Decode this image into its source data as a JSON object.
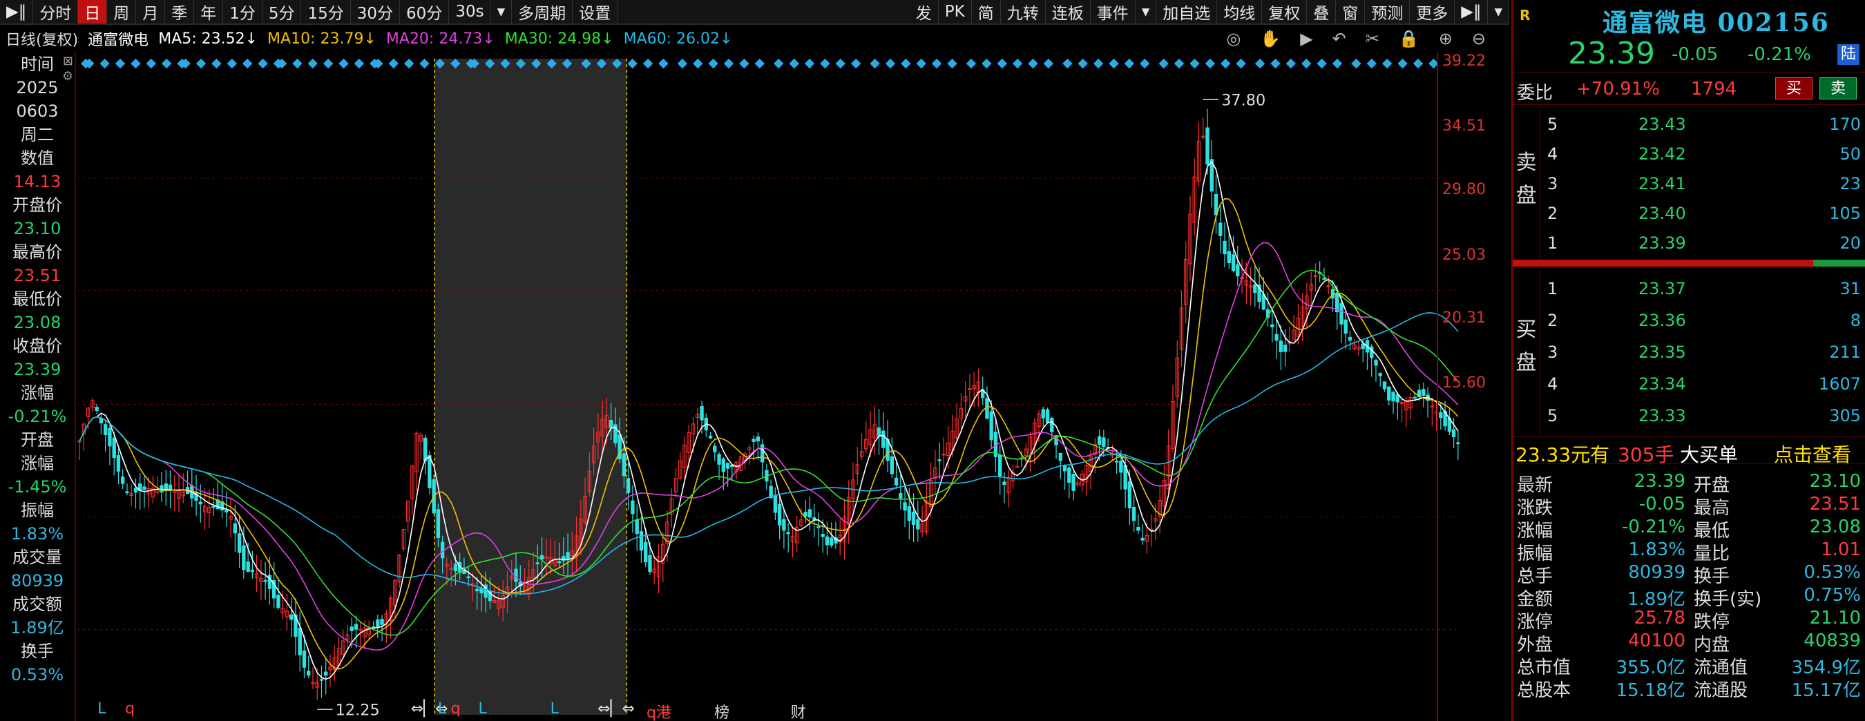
{
  "toolbar": {
    "left": [
      "▶‖",
      "分时",
      "日",
      "周",
      "月",
      "季",
      "年",
      "1分",
      "5分",
      "15分",
      "30分",
      "60分",
      "30s",
      "▾",
      "多周期",
      "设置"
    ],
    "active_index": 2,
    "right": [
      "发",
      "PK",
      "简",
      "九转",
      "连板",
      "事件",
      "▾",
      "加自选",
      "均线",
      "复权",
      "叠",
      "窗",
      "预测",
      "更多",
      "▶‖",
      "▾"
    ]
  },
  "maline": {
    "period": "日线(复权)",
    "name": "通富微电",
    "ma5": "MA5: 23.52↓",
    "ma10": "MA10: 23.79↓",
    "ma20": "MA20: 24.73↓",
    "ma30": "MA30: 24.98↓",
    "ma60": "MA60: 26.02↓",
    "tools": [
      "◎",
      "✋",
      "▶",
      "↶",
      "✂",
      "🔒",
      "⊕",
      "⊖"
    ]
  },
  "left": [
    {
      "t": "时间",
      "c": "w"
    },
    {
      "t": "2025",
      "c": "w"
    },
    {
      "t": "0603",
      "c": "w"
    },
    {
      "t": "周二",
      "c": "w"
    },
    {
      "t": "数值",
      "c": "w"
    },
    {
      "t": "14.13",
      "c": "r"
    },
    {
      "t": "开盘价",
      "c": "w"
    },
    {
      "t": "23.10",
      "c": "g"
    },
    {
      "t": "最高价",
      "c": "w"
    },
    {
      "t": "23.51",
      "c": "r"
    },
    {
      "t": "最低价",
      "c": "w"
    },
    {
      "t": "23.08",
      "c": "g"
    },
    {
      "t": "收盘价",
      "c": "w"
    },
    {
      "t": "23.39",
      "c": "g"
    },
    {
      "t": "涨幅",
      "c": "w"
    },
    {
      "t": "-0.21%",
      "c": "g"
    },
    {
      "t": "开盘",
      "c": "w"
    },
    {
      "t": "涨幅",
      "c": "w"
    },
    {
      "t": "-1.45%",
      "c": "g"
    },
    {
      "t": "振幅",
      "c": "w"
    },
    {
      "t": "1.83%",
      "c": "c"
    },
    {
      "t": "成交量",
      "c": "w"
    },
    {
      "t": "80939",
      "c": "c"
    },
    {
      "t": "成交额",
      "c": "w"
    },
    {
      "t": "1.89亿",
      "c": "c"
    },
    {
      "t": "换手",
      "c": "w"
    },
    {
      "t": "0.53%",
      "c": "c"
    }
  ],
  "yticks": [
    "39.22",
    "34.51",
    "29.80",
    "25.03",
    "20.31",
    "15.60"
  ],
  "chart_data": {
    "type": "candlestick",
    "title": "",
    "y_ticks": [
      39.22,
      34.51,
      29.8,
      25.03,
      20.31,
      15.6
    ],
    "ylim": [
      13.2,
      39.22
    ],
    "annotations": [
      {
        "text": "37.80",
        "value": 37.8,
        "kind": "high"
      },
      {
        "text": "12.25",
        "value": 12.25,
        "kind": "low"
      }
    ],
    "highlight_range": [
      0.2583,
      0.3973
    ],
    "close_series": [
      23.5,
      24.8,
      23.6,
      22.9,
      21.9,
      21.7,
      21.2,
      20.8,
      21.3,
      21.9,
      21.5,
      20.7,
      20.1,
      19.9,
      18.3,
      18.6,
      17.9,
      16.2,
      15.7,
      14.1,
      13.8,
      14.1,
      14.6,
      14.9,
      15.2,
      15.9,
      16.4,
      17.9,
      20.2,
      23.8,
      21.3,
      19.1,
      18.6,
      17.9,
      16.7,
      16.4,
      17.0,
      18.4,
      17.6,
      17.9,
      18.1,
      18.3,
      19.1,
      20.9,
      23.2,
      24.2,
      22.8,
      21.5,
      19.6,
      18.1,
      18.9,
      21.3,
      23.6,
      25.2,
      24.1,
      22.1,
      21.9,
      22.6,
      23.9,
      22.0,
      20.1,
      19.1,
      19.8,
      20.1,
      19.6,
      19.8,
      21.4,
      22.6,
      23.9,
      23.2,
      22.1,
      20.4,
      19.3,
      21.6,
      22.9,
      24.8,
      26.1,
      25.9,
      23.1,
      21.2,
      22.5,
      23.7,
      24.9,
      23.8,
      22.1,
      21.3,
      22.8,
      23.9,
      23.1,
      21.9,
      20.1,
      19.6,
      20.6,
      22.4,
      26.8,
      32.2,
      36.8,
      34.2,
      31.8,
      30.3,
      29.6,
      29.0,
      28.7,
      27.6,
      28.4,
      29.1,
      30.1,
      29.9,
      28.9,
      28.0,
      27.2,
      26.1,
      24.9,
      25.4,
      25.9,
      25.6,
      24.4,
      23.5,
      23.4
    ],
    "series": [
      {
        "name": "MA5",
        "value": 23.52,
        "color": "#ffffff"
      },
      {
        "name": "MA10",
        "value": 23.79,
        "color": "#f0c000"
      },
      {
        "name": "MA20",
        "value": 24.73,
        "color": "#e040e0"
      },
      {
        "name": "MA30",
        "value": 24.98,
        "color": "#30e030"
      },
      {
        "name": "MA60",
        "value": 26.02,
        "color": "#20b8e8"
      }
    ]
  },
  "bottombar": [
    {
      "t": "L",
      "c": "c",
      "x": 0.0148
    },
    {
      "t": "q",
      "c": "r",
      "x": 0.0351
    },
    {
      "t": "⇔▏⇔",
      "c": "w",
      "x": 0.2453
    },
    {
      "t": "L",
      "c": "c",
      "x": 0.2652
    },
    {
      "t": "q",
      "c": "r",
      "x": 0.2747
    },
    {
      "t": "L",
      "c": "c",
      "x": 0.295
    },
    {
      "t": "L",
      "c": "c",
      "x": 0.3479
    },
    {
      "t": "⇔▏⇔",
      "c": "w",
      "x": 0.3827
    },
    {
      "t": "q港",
      "c": "r",
      "x": 0.4187
    },
    {
      "t": "榜",
      "c": "w",
      "x": 0.4685
    },
    {
      "t": "财",
      "c": "w",
      "x": 0.5247
    }
  ],
  "right": {
    "r_badge": "R",
    "name": "通富微电 002156",
    "price": "23.39",
    "change": "-0.05",
    "pct": "-0.21%",
    "lu": "陆",
    "wb_label": "委比",
    "wb_pct": "+70.91%",
    "wb_num": "1794",
    "buy": "买",
    "sell": "卖",
    "sell_side": [
      "卖",
      "盘"
    ],
    "buy_side": [
      "买",
      "盘"
    ],
    "asks": [
      {
        "lv": "5",
        "p": "23.43",
        "q": "170"
      },
      {
        "lv": "4",
        "p": "23.42",
        "q": "50"
      },
      {
        "lv": "3",
        "p": "23.41",
        "q": "23"
      },
      {
        "lv": "2",
        "p": "23.40",
        "q": "105"
      },
      {
        "lv": "1",
        "p": "23.39",
        "q": "20"
      }
    ],
    "bids": [
      {
        "lv": "1",
        "p": "23.37",
        "q": "31"
      },
      {
        "lv": "2",
        "p": "23.36",
        "q": "8"
      },
      {
        "lv": "3",
        "p": "23.35",
        "q": "211"
      },
      {
        "lv": "4",
        "p": "23.34",
        "q": "1607"
      },
      {
        "lv": "5",
        "p": "23.33",
        "q": "305"
      }
    ],
    "big_price": "23.33元有",
    "big_qty": "305手",
    "big_label": "大买单",
    "big_link": "点击查看",
    "stats": [
      {
        "k1": "最新",
        "v1": "23.39",
        "c1": "g",
        "k2": "开盘",
        "v2": "23.10",
        "c2": "g"
      },
      {
        "k1": "涨跌",
        "v1": "-0.05",
        "c1": "g",
        "k2": "最高",
        "v2": "23.51",
        "c2": "r"
      },
      {
        "k1": "涨幅",
        "v1": "-0.21%",
        "c1": "g",
        "k2": "最低",
        "v2": "23.08",
        "c2": "g"
      },
      {
        "k1": "振幅",
        "v1": "1.83%",
        "c1": "c",
        "k2": "量比",
        "v2": "1.01",
        "c2": "r"
      },
      {
        "k1": "总手",
        "v1": "80939",
        "c1": "c",
        "k2": "换手",
        "v2": "0.53%",
        "c2": "c"
      },
      {
        "k1": "金额",
        "v1": "1.89亿",
        "c1": "c",
        "k2": "换手(实)",
        "v2": "0.75%",
        "c2": "c"
      },
      {
        "k1": "涨停",
        "v1": "25.78",
        "c1": "r",
        "k2": "跌停",
        "v2": "21.10",
        "c2": "g"
      },
      {
        "k1": "外盘",
        "v1": "40100",
        "c1": "r",
        "k2": "内盘",
        "v2": "40839",
        "c2": "g"
      },
      {
        "k1": "总市值",
        "v1": "355.0亿",
        "c1": "c",
        "k2": "流通值",
        "v2": "354.9亿",
        "c2": "c"
      },
      {
        "k1": "总股本",
        "v1": "15.18亿",
        "c1": "c",
        "k2": "流通股",
        "v2": "15.17亿",
        "c2": "c"
      }
    ]
  }
}
